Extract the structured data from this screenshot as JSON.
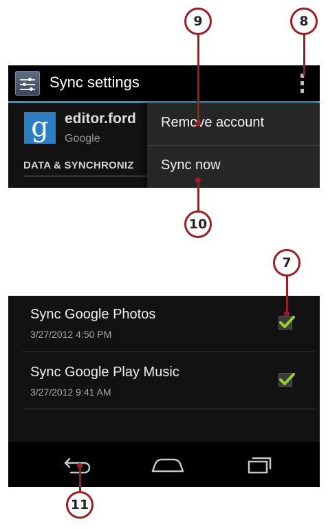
{
  "callouts": {
    "c9": "9",
    "c8": "8",
    "c10": "10",
    "c7": "7",
    "c11": "11"
  },
  "header": {
    "title": "Sync settings"
  },
  "account": {
    "icon_letter": "g",
    "email": "editor.ford",
    "type": "Google"
  },
  "section": {
    "header": "DATA & SYNCHRONIZ"
  },
  "menu": {
    "items": [
      {
        "label": "Remove account"
      },
      {
        "label": "Sync now"
      }
    ]
  },
  "sync_items": [
    {
      "label": "Sync Google Photos",
      "timestamp": "3/27/2012 4:50 PM",
      "checked": true
    },
    {
      "label": "Sync Google Play Music",
      "timestamp": "3/27/2012 9:41 AM",
      "checked": true
    }
  ],
  "nav": {
    "back_icon": "back-icon",
    "home_icon": "home-icon",
    "recents_icon": "recent-apps-icon"
  },
  "colors": {
    "accent_line": "#2f98c4",
    "callout_ring": "#9b1c23",
    "check_green": "#9acd32",
    "google_blue": "#2d7dc3"
  }
}
